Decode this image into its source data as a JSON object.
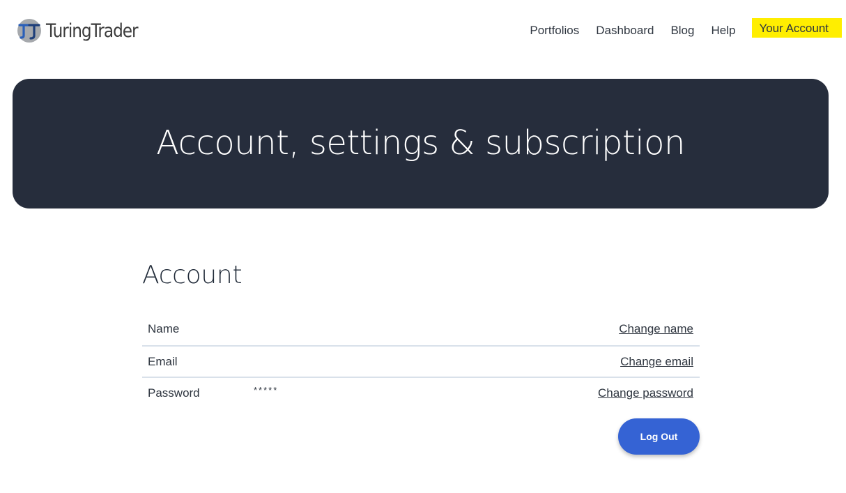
{
  "brand": {
    "name": "TuringTrader",
    "logo_icon": "tt-logo-icon"
  },
  "nav": {
    "items": [
      {
        "label": "Portfolios"
      },
      {
        "label": "Dashboard"
      },
      {
        "label": "Blog"
      },
      {
        "label": "Help"
      },
      {
        "label": "Your Account",
        "active": true
      }
    ],
    "highlight_color": "#ffee00"
  },
  "hero": {
    "title": "Account, settings & subscription",
    "background": "#262d3c"
  },
  "account": {
    "title": "Account",
    "rows": [
      {
        "label": "Name",
        "value": "",
        "action": "Change name"
      },
      {
        "label": "Email",
        "value": "",
        "action": "Change email"
      },
      {
        "label": "Password",
        "value": "*****",
        "action": "Change password"
      }
    ],
    "logout_label": "Log Out",
    "accent": "#3563d4"
  }
}
